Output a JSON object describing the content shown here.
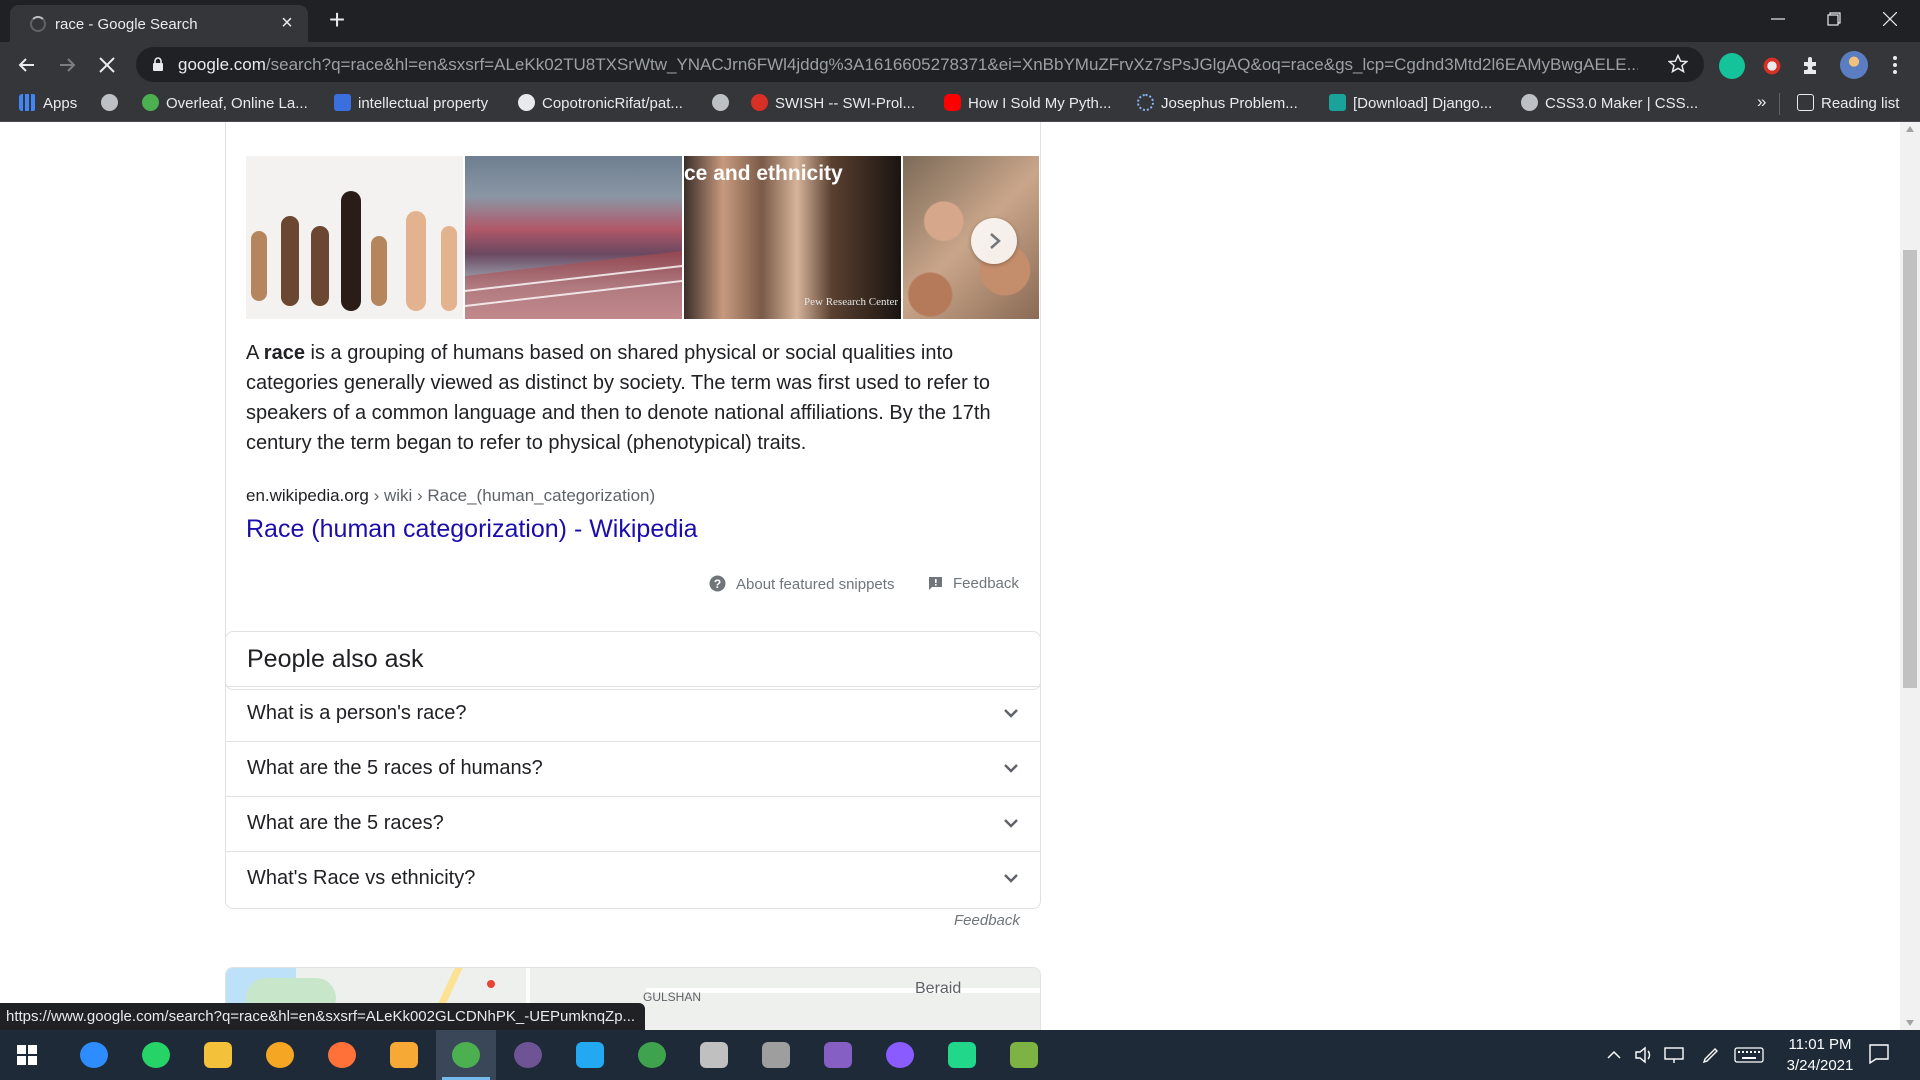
{
  "tab": {
    "title": "race - Google Search"
  },
  "omnibox": {
    "host": "google.com",
    "path": "/search?q=race&hl=en&sxsrf=ALeKk02TU8TXSrWtw_YNACJrn6FWl4jddg%3A1616605278371&ei=XnBbYMuZFrvXz7sPsJGlgAQ&oq=race&gs_lcp=Cgdnd3Mtd2l6EAMyBwgAELE..."
  },
  "bookmarks": [
    {
      "label": "Apps",
      "icon": "apps-grid-icon",
      "color": "#4285f4"
    },
    {
      "label": "",
      "icon": "globe-icon",
      "color": "#bdc1c6"
    },
    {
      "label": "Overleaf, Online La...",
      "icon": "overleaf-icon",
      "color": "#4cb050"
    },
    {
      "label": "intellectual property",
      "icon": "scholar-icon",
      "color": "#3b6fe0"
    },
    {
      "label": "CopotronicRifat/pat...",
      "icon": "github-icon",
      "color": "#e8eaed"
    },
    {
      "label": "",
      "icon": "globe-icon",
      "color": "#bdc1c6"
    },
    {
      "label": "SWISH -- SWI-Prol...",
      "icon": "swish-icon",
      "color": "#d93025"
    },
    {
      "label": "How I Sold My Pyth...",
      "icon": "youtube-icon",
      "color": "#ff0000"
    },
    {
      "label": "Josephus Problem...",
      "icon": "loading-icon",
      "color": "#8ab4f8"
    },
    {
      "label": "[Download] Django...",
      "icon": "django-icon",
      "color": "#1aa39a"
    },
    {
      "label": "CSS3.0 Maker | CSS...",
      "icon": "globe-icon",
      "color": "#bdc1c6"
    }
  ],
  "bookmarks_overflow": "»",
  "reading_list": "Reading list",
  "snippet": {
    "image_title": "ce and ethnicity",
    "image_credit": "Pew Research Center",
    "desc_prefix": "A ",
    "desc_bold": "race",
    "desc_rest": " is a grouping of humans based on shared physical or social qualities into categories generally viewed as distinct by society. The term was first used to refer to speakers of a common language and then to denote national affiliations. By the 17th century the term began to refer to physical (phenotypical) traits.",
    "cite_domain": "en.wikipedia.org",
    "cite_path": " › wiki › Race_(human_categorization)",
    "link_title": "Race (human categorization) - Wikipedia",
    "about_label": "About featured snippets",
    "feedback_label": "Feedback"
  },
  "people_also_ask": {
    "title": "People also ask",
    "questions": [
      "What is a person's race?",
      "What are the 5 races of humans?",
      "What are the 5 races?",
      "What's Race vs ethnicity?"
    ],
    "feedback_label": "Feedback"
  },
  "map": {
    "label_gulshan": "GULSHAN",
    "label_beraid": "Beraid"
  },
  "status_url": "https://www.google.com/search?q=race&hl=en&sxsrf=ALeKk002GLCDNhPK_-UEPumknqZp...",
  "taskbar": {
    "apps": [
      {
        "name": "teams-icon",
        "color": "#2d8cff"
      },
      {
        "name": "whatsapp-icon",
        "color": "#25d366"
      },
      {
        "name": "file-explorer-icon",
        "color": "#f3c13a"
      },
      {
        "name": "vpn-icon",
        "color": "#f5a623"
      },
      {
        "name": "firefox-icon",
        "color": "#ff7139"
      },
      {
        "name": "photo-app-icon",
        "color": "#f7a935"
      },
      {
        "name": "chrome-icon",
        "color": "#4caf50"
      },
      {
        "name": "github-desktop-icon",
        "color": "#6e5494"
      },
      {
        "name": "vscode-icon",
        "color": "#23a9f2"
      },
      {
        "name": "earth-icon",
        "color": "#3fa34d"
      },
      {
        "name": "spyder-icon",
        "color": "#c0c0c0"
      },
      {
        "name": "anaconda-icon",
        "color": "#9e9e9e"
      },
      {
        "name": "visual-studio-icon",
        "color": "#865fc5"
      },
      {
        "name": "messenger-icon",
        "color": "#8a5cff"
      },
      {
        "name": "pycharm-icon",
        "color": "#21d789"
      },
      {
        "name": "notepad-icon",
        "color": "#7cb342"
      }
    ],
    "clock_time": "11:01 PM",
    "clock_date": "3/24/2021"
  }
}
